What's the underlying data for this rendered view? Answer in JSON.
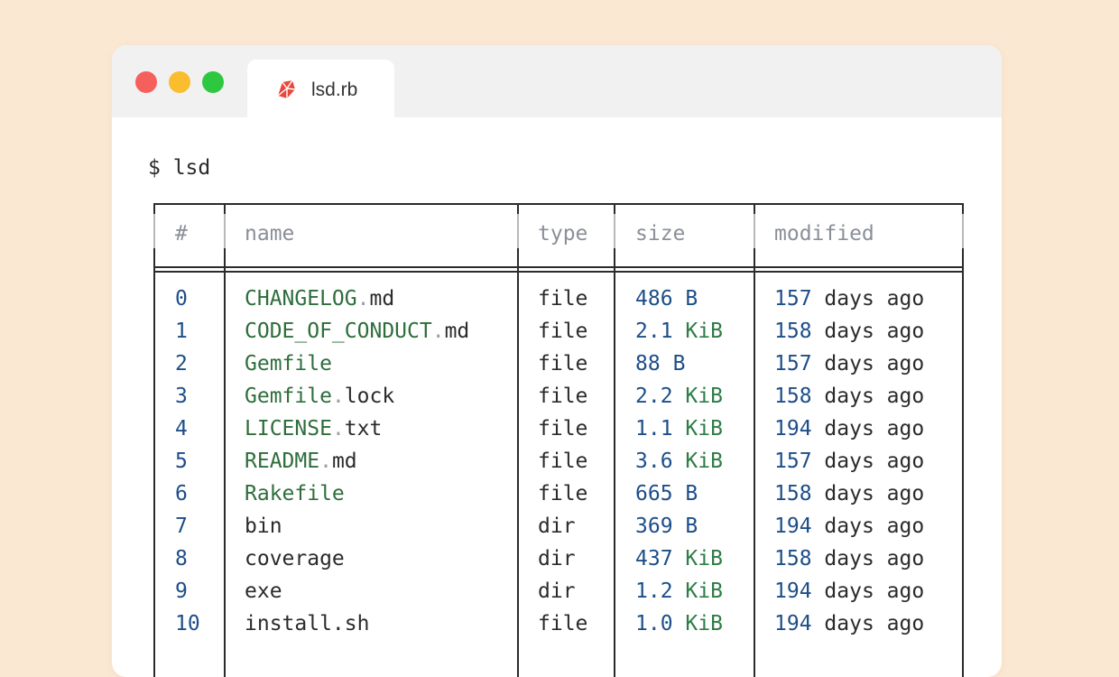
{
  "window": {
    "tab_title": "lsd.rb",
    "tab_icon": "ruby-gem-icon"
  },
  "terminal": {
    "prompt": "$ lsd",
    "headers": [
      "#",
      "name",
      "type",
      "size",
      "modified"
    ],
    "rows": [
      {
        "index": "0",
        "base": "CHANGELOG",
        "dot": ".",
        "ext": "md",
        "type": "file",
        "size_num": "486",
        "size_unit": "B",
        "mod_num": "157",
        "mod_text": "days ago",
        "name_style": "green"
      },
      {
        "index": "1",
        "base": "CODE_OF_CONDUCT",
        "dot": ".",
        "ext": "md",
        "type": "file",
        "size_num": "2.1",
        "size_unit": "KiB",
        "mod_num": "158",
        "mod_text": "days ago",
        "name_style": "green"
      },
      {
        "index": "2",
        "base": "Gemfile",
        "dot": "",
        "ext": "",
        "type": "file",
        "size_num": "88",
        "size_unit": "B",
        "mod_num": "157",
        "mod_text": "days ago",
        "name_style": "green"
      },
      {
        "index": "3",
        "base": "Gemfile",
        "dot": ".",
        "ext": "lock",
        "type": "file",
        "size_num": "2.2",
        "size_unit": "KiB",
        "mod_num": "158",
        "mod_text": "days ago",
        "name_style": "green"
      },
      {
        "index": "4",
        "base": "LICENSE",
        "dot": ".",
        "ext": "txt",
        "type": "file",
        "size_num": "1.1",
        "size_unit": "KiB",
        "mod_num": "194",
        "mod_text": "days ago",
        "name_style": "green"
      },
      {
        "index": "5",
        "base": "README",
        "dot": ".",
        "ext": "md",
        "type": "file",
        "size_num": "3.6",
        "size_unit": "KiB",
        "mod_num": "157",
        "mod_text": "days ago",
        "name_style": "green"
      },
      {
        "index": "6",
        "base": "Rakefile",
        "dot": "",
        "ext": "",
        "type": "file",
        "size_num": "665",
        "size_unit": "B",
        "mod_num": "158",
        "mod_text": "days ago",
        "name_style": "green"
      },
      {
        "index": "7",
        "base": "bin",
        "dot": "",
        "ext": "",
        "type": "dir",
        "size_num": "369",
        "size_unit": "B",
        "mod_num": "194",
        "mod_text": "days ago",
        "name_style": "plain"
      },
      {
        "index": "8",
        "base": "coverage",
        "dot": "",
        "ext": "",
        "type": "dir",
        "size_num": "437",
        "size_unit": "KiB",
        "mod_num": "158",
        "mod_text": "days ago",
        "name_style": "plain"
      },
      {
        "index": "9",
        "base": "exe",
        "dot": "",
        "ext": "",
        "type": "dir",
        "size_num": "1.2",
        "size_unit": "KiB",
        "mod_num": "194",
        "mod_text": "days ago",
        "name_style": "plain"
      },
      {
        "index": "10",
        "base": "install.sh",
        "dot": "",
        "ext": "",
        "type": "file",
        "size_num": "1.0",
        "size_unit": "KiB",
        "mod_num": "194",
        "mod_text": "days ago",
        "name_style": "plain"
      }
    ]
  },
  "colors": {
    "page_background": "#fbe8d3",
    "number_blue": "#1d4e89",
    "name_green": "#2e6e3b",
    "header_gray": "#8a8f98"
  }
}
